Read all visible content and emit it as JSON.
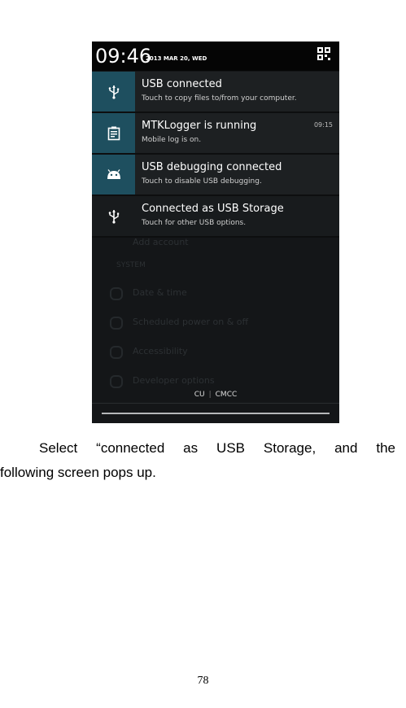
{
  "status_bar": {
    "time": "09:46",
    "date": "2013 MAR 20, WED",
    "settings_icon": "quick-settings-icon"
  },
  "notifications": [
    {
      "icon": "usb-icon",
      "title": "USB connected",
      "subtitle": "Touch to copy files to/from your computer.",
      "time": ""
    },
    {
      "icon": "logger-icon",
      "title": "MTKLogger is running",
      "subtitle": "Mobile log is on.",
      "time": "09:15"
    },
    {
      "icon": "android-debug-icon",
      "title": "USB debugging connected",
      "subtitle": "Touch to disable USB debugging.",
      "time": ""
    },
    {
      "icon": "usb-icon",
      "title": "Connected as USB Storage",
      "subtitle": "Touch for other USB options.",
      "time": ""
    }
  ],
  "background_settings": [
    "Add account",
    "SYSTEM",
    "Date & time",
    "Scheduled power on & off",
    "Accessibility",
    "Developer options"
  ],
  "carrier": {
    "left": "CU",
    "separator": "|",
    "right": "CMCC"
  },
  "caption": {
    "line1": "Select “connected as USB Storage, and the",
    "line2": "following screen pops up."
  },
  "page_number": "78",
  "colors": {
    "icon_tile": "#1e4f5f",
    "notification_bg": "#1d2022",
    "status_bar_bg": "#050505"
  }
}
